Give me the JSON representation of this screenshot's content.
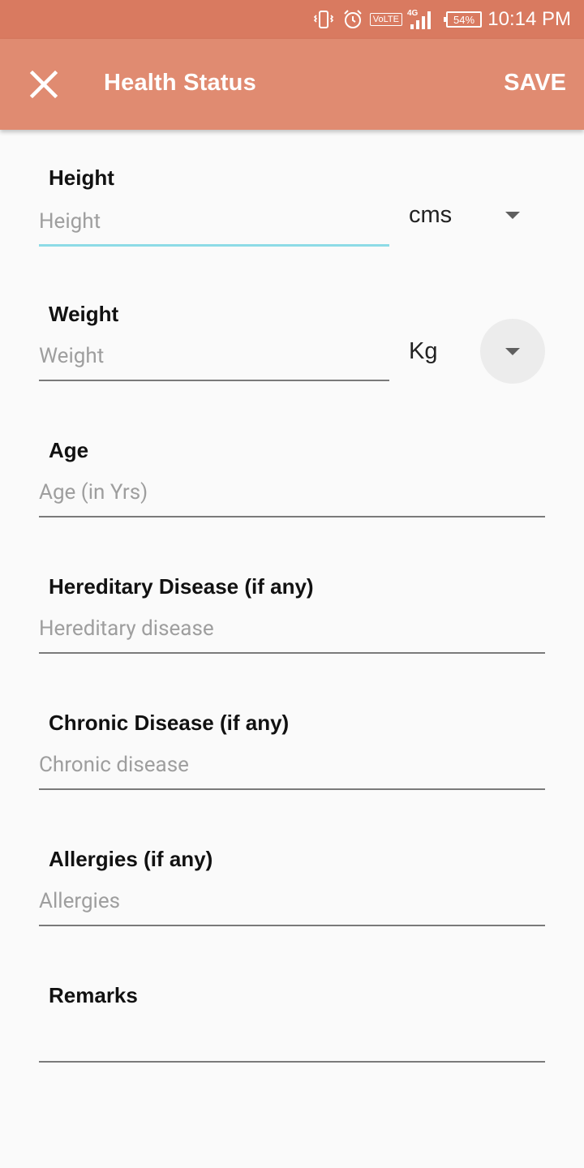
{
  "status_bar": {
    "time": "10:14 PM",
    "battery": "54%",
    "network": "4G",
    "volte": "VoLTE",
    "icons": [
      "vibrate-icon",
      "alarm-icon",
      "volte-icon",
      "signal-icon",
      "battery-icon"
    ]
  },
  "app_bar": {
    "title": "Health Status",
    "save_label": "SAVE",
    "close_icon": "close-icon",
    "background": "#e08b71"
  },
  "colors": {
    "status_bar": "#d97a60",
    "app_bar": "#e08b71",
    "focus_underline": "#8ddbe6"
  },
  "form": {
    "height": {
      "label": "Height",
      "placeholder": "Height",
      "value": "",
      "unit": "cms"
    },
    "weight": {
      "label": "Weight",
      "placeholder": "Weight",
      "value": "",
      "unit": "Kg"
    },
    "age": {
      "label": "Age",
      "placeholder": "Age (in Yrs)",
      "value": ""
    },
    "hereditary": {
      "label": "Hereditary Disease (if any)",
      "placeholder": "Hereditary disease",
      "value": ""
    },
    "chronic": {
      "label": "Chronic Disease (if any)",
      "placeholder": "Chronic disease",
      "value": ""
    },
    "allergies": {
      "label": "Allergies (if any)",
      "placeholder": "Allergies",
      "value": ""
    },
    "remarks": {
      "label": "Remarks",
      "placeholder": "",
      "value": ""
    }
  }
}
